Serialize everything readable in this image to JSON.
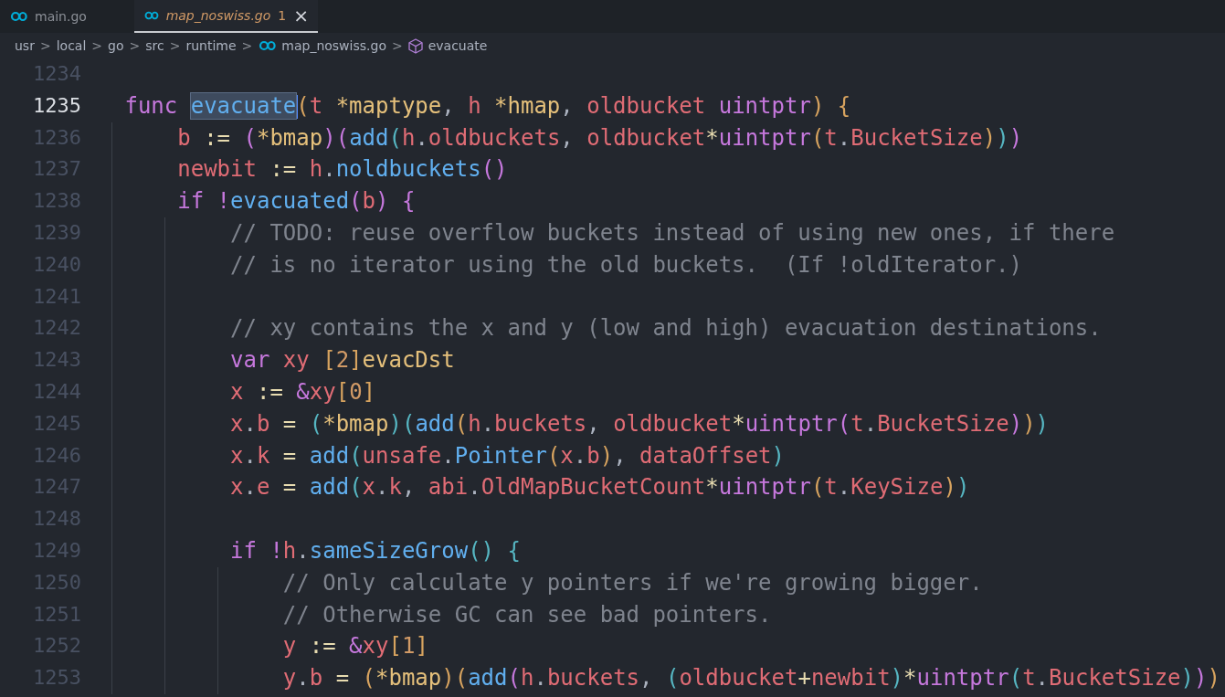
{
  "tabs": [
    {
      "label": "main.go",
      "selected": false,
      "italic": false
    },
    {
      "label": "map_noswiss.go",
      "selected": true,
      "italic": true,
      "problems": "1",
      "close": "×"
    }
  ],
  "breadcrumbs": [
    {
      "label": "usr",
      "kind": "folder"
    },
    {
      "label": "local",
      "kind": "folder"
    },
    {
      "label": "go",
      "kind": "folder"
    },
    {
      "label": "src",
      "kind": "folder"
    },
    {
      "label": "runtime",
      "kind": "folder"
    },
    {
      "label": "map_noswiss.go",
      "kind": "file"
    },
    {
      "label": "evacuate",
      "kind": "symbol"
    }
  ],
  "separator": ">",
  "lines": [
    {
      "number": "1234",
      "current": false
    },
    {
      "number": "1235",
      "current": true,
      "tokens": [
        {
          "text": "func ",
          "kind": "kw"
        },
        {
          "text": "evacuate",
          "kind": "fn",
          "selected": true
        },
        {
          "text": "(",
          "kind": "b1"
        },
        {
          "text": "t ",
          "kind": "var"
        },
        {
          "text": "*maptype",
          "kind": "type"
        },
        {
          "text": ", ",
          "kind": "p"
        },
        {
          "text": "h ",
          "kind": "var"
        },
        {
          "text": "*hmap",
          "kind": "type"
        },
        {
          "text": ", ",
          "kind": "p"
        },
        {
          "text": "oldbucket ",
          "kind": "var"
        },
        {
          "text": "uintptr",
          "kind": "kw"
        },
        {
          "text": ") {",
          "kind": "b1"
        }
      ],
      "children": [
        {
          "number": "1236",
          "current": false,
          "tokens": [
            {
              "text": "b ",
              "kind": "var"
            },
            {
              "text": ":= ",
              "kind": "op"
            },
            {
              "text": "(",
              "kind": "b2"
            },
            {
              "text": "*bmap",
              "kind": "type"
            },
            {
              "text": ")(",
              "kind": "b2"
            },
            {
              "text": "add",
              "kind": "fn"
            },
            {
              "text": "(",
              "kind": "b3"
            },
            {
              "text": "h",
              "kind": "var"
            },
            {
              "text": ".",
              "kind": "p"
            },
            {
              "text": "oldbuckets",
              "kind": "var"
            },
            {
              "text": ", ",
              "kind": "p"
            },
            {
              "text": "oldbucket",
              "kind": "var"
            },
            {
              "text": "*",
              "kind": "op"
            },
            {
              "text": "uintptr",
              "kind": "kw"
            },
            {
              "text": "(",
              "kind": "b1"
            },
            {
              "text": "t",
              "kind": "var"
            },
            {
              "text": ".",
              "kind": "p"
            },
            {
              "text": "BucketSize",
              "kind": "var"
            },
            {
              "text": ")",
              "kind": "b1"
            },
            {
              "text": ")",
              "kind": "b3"
            },
            {
              "text": ")",
              "kind": "b2"
            }
          ]
        },
        {
          "number": "1237",
          "current": false,
          "tokens": [
            {
              "text": "newbit ",
              "kind": "var"
            },
            {
              "text": ":= ",
              "kind": "op"
            },
            {
              "text": "h",
              "kind": "var"
            },
            {
              "text": ".",
              "kind": "p"
            },
            {
              "text": "noldbuckets",
              "kind": "fn"
            },
            {
              "text": "()",
              "kind": "b2"
            }
          ]
        },
        {
          "number": "1238",
          "current": false,
          "tokens": [
            {
              "text": "if ",
              "kind": "kw"
            },
            {
              "text": "!",
              "kind": "kw"
            },
            {
              "text": "evacuated",
              "kind": "fn"
            },
            {
              "text": "(",
              "kind": "b2"
            },
            {
              "text": "b",
              "kind": "var"
            },
            {
              "text": ") {",
              "kind": "b2"
            }
          ],
          "children": [
            {
              "number": "1239",
              "current": false,
              "tokens": [
                {
                  "text": "// TODO: reuse overflow buckets instead of using new ones, if there",
                  "kind": "cm"
                }
              ]
            },
            {
              "number": "1240",
              "current": false,
              "tokens": [
                {
                  "text": "// is no iterator using the old buckets.  (If !oldIterator.)",
                  "kind": "cm"
                }
              ]
            },
            {
              "number": "1241",
              "current": false
            },
            {
              "number": "1242",
              "current": false,
              "tokens": [
                {
                  "text": "// xy contains the x and y (low and high) evacuation destinations.",
                  "kind": "cm"
                }
              ]
            },
            {
              "number": "1243",
              "current": false,
              "tokens": [
                {
                  "text": "var ",
                  "kind": "kw"
                },
                {
                  "text": "xy ",
                  "kind": "var"
                },
                {
                  "text": "[",
                  "kind": "b1"
                },
                {
                  "text": "2",
                  "kind": "num"
                },
                {
                  "text": "]",
                  "kind": "b1"
                },
                {
                  "text": "evacDst",
                  "kind": "type"
                }
              ]
            },
            {
              "number": "1244",
              "current": false,
              "tokens": [
                {
                  "text": "x ",
                  "kind": "var"
                },
                {
                  "text": ":= ",
                  "kind": "op"
                },
                {
                  "text": "&",
                  "kind": "kw"
                },
                {
                  "text": "xy",
                  "kind": "var"
                },
                {
                  "text": "[",
                  "kind": "b1"
                },
                {
                  "text": "0",
                  "kind": "num"
                },
                {
                  "text": "]",
                  "kind": "b1"
                }
              ]
            },
            {
              "number": "1245",
              "current": false,
              "tokens": [
                {
                  "text": "x",
                  "kind": "var"
                },
                {
                  "text": ".",
                  "kind": "p"
                },
                {
                  "text": "b ",
                  "kind": "var"
                },
                {
                  "text": "= ",
                  "kind": "op"
                },
                {
                  "text": "(",
                  "kind": "b3"
                },
                {
                  "text": "*bmap",
                  "kind": "type"
                },
                {
                  "text": ")(",
                  "kind": "b3"
                },
                {
                  "text": "add",
                  "kind": "fn"
                },
                {
                  "text": "(",
                  "kind": "b1"
                },
                {
                  "text": "h",
                  "kind": "var"
                },
                {
                  "text": ".",
                  "kind": "p"
                },
                {
                  "text": "buckets",
                  "kind": "var"
                },
                {
                  "text": ", ",
                  "kind": "p"
                },
                {
                  "text": "oldbucket",
                  "kind": "var"
                },
                {
                  "text": "*",
                  "kind": "op"
                },
                {
                  "text": "uintptr",
                  "kind": "kw"
                },
                {
                  "text": "(",
                  "kind": "b2"
                },
                {
                  "text": "t",
                  "kind": "var"
                },
                {
                  "text": ".",
                  "kind": "p"
                },
                {
                  "text": "BucketSize",
                  "kind": "var"
                },
                {
                  "text": ")",
                  "kind": "b2"
                },
                {
                  "text": ")",
                  "kind": "b1"
                },
                {
                  "text": ")",
                  "kind": "b3"
                }
              ]
            },
            {
              "number": "1246",
              "current": false,
              "tokens": [
                {
                  "text": "x",
                  "kind": "var"
                },
                {
                  "text": ".",
                  "kind": "p"
                },
                {
                  "text": "k ",
                  "kind": "var"
                },
                {
                  "text": "= ",
                  "kind": "op"
                },
                {
                  "text": "add",
                  "kind": "fn"
                },
                {
                  "text": "(",
                  "kind": "b3"
                },
                {
                  "text": "unsafe",
                  "kind": "var"
                },
                {
                  "text": ".",
                  "kind": "p"
                },
                {
                  "text": "Pointer",
                  "kind": "fn"
                },
                {
                  "text": "(",
                  "kind": "b1"
                },
                {
                  "text": "x",
                  "kind": "var"
                },
                {
                  "text": ".",
                  "kind": "p"
                },
                {
                  "text": "b",
                  "kind": "var"
                },
                {
                  "text": ")",
                  "kind": "b1"
                },
                {
                  "text": ", ",
                  "kind": "p"
                },
                {
                  "text": "dataOffset",
                  "kind": "var"
                },
                {
                  "text": ")",
                  "kind": "b3"
                }
              ]
            },
            {
              "number": "1247",
              "current": false,
              "tokens": [
                {
                  "text": "x",
                  "kind": "var"
                },
                {
                  "text": ".",
                  "kind": "p"
                },
                {
                  "text": "e ",
                  "kind": "var"
                },
                {
                  "text": "= ",
                  "kind": "op"
                },
                {
                  "text": "add",
                  "kind": "fn"
                },
                {
                  "text": "(",
                  "kind": "b3"
                },
                {
                  "text": "x",
                  "kind": "var"
                },
                {
                  "text": ".",
                  "kind": "p"
                },
                {
                  "text": "k",
                  "kind": "var"
                },
                {
                  "text": ", ",
                  "kind": "p"
                },
                {
                  "text": "abi",
                  "kind": "var"
                },
                {
                  "text": ".",
                  "kind": "p"
                },
                {
                  "text": "OldMapBucketCount",
                  "kind": "var"
                },
                {
                  "text": "*",
                  "kind": "op"
                },
                {
                  "text": "uintptr",
                  "kind": "kw"
                },
                {
                  "text": "(",
                  "kind": "b1"
                },
                {
                  "text": "t",
                  "kind": "var"
                },
                {
                  "text": ".",
                  "kind": "p"
                },
                {
                  "text": "KeySize",
                  "kind": "var"
                },
                {
                  "text": ")",
                  "kind": "b1"
                },
                {
                  "text": ")",
                  "kind": "b3"
                }
              ]
            },
            {
              "number": "1248",
              "current": false
            },
            {
              "number": "1249",
              "current": false,
              "tokens": [
                {
                  "text": "if ",
                  "kind": "kw"
                },
                {
                  "text": "!",
                  "kind": "kw"
                },
                {
                  "text": "h",
                  "kind": "var"
                },
                {
                  "text": ".",
                  "kind": "p"
                },
                {
                  "text": "sameSizeGrow",
                  "kind": "fn"
                },
                {
                  "text": "() {",
                  "kind": "b3"
                }
              ],
              "children": [
                {
                  "number": "1250",
                  "current": false,
                  "tokens": [
                    {
                      "text": "// Only calculate y pointers if we're growing bigger.",
                      "kind": "cm"
                    }
                  ]
                },
                {
                  "number": "1251",
                  "current": false,
                  "tokens": [
                    {
                      "text": "// Otherwise GC can see bad pointers.",
                      "kind": "cm"
                    }
                  ]
                },
                {
                  "number": "1252",
                  "current": false,
                  "tokens": [
                    {
                      "text": "y ",
                      "kind": "var"
                    },
                    {
                      "text": ":= ",
                      "kind": "op"
                    },
                    {
                      "text": "&",
                      "kind": "kw"
                    },
                    {
                      "text": "xy",
                      "kind": "var"
                    },
                    {
                      "text": "[",
                      "kind": "b1"
                    },
                    {
                      "text": "1",
                      "kind": "num"
                    },
                    {
                      "text": "]",
                      "kind": "b1"
                    }
                  ]
                },
                {
                  "number": "1253",
                  "current": false,
                  "tokens": [
                    {
                      "text": "y",
                      "kind": "var"
                    },
                    {
                      "text": ".",
                      "kind": "p"
                    },
                    {
                      "text": "b ",
                      "kind": "var"
                    },
                    {
                      "text": "= ",
                      "kind": "op"
                    },
                    {
                      "text": "(",
                      "kind": "b1"
                    },
                    {
                      "text": "*bmap",
                      "kind": "type"
                    },
                    {
                      "text": ")(",
                      "kind": "b1"
                    },
                    {
                      "text": "add",
                      "kind": "fn"
                    },
                    {
                      "text": "(",
                      "kind": "b2"
                    },
                    {
                      "text": "h",
                      "kind": "var"
                    },
                    {
                      "text": ".",
                      "kind": "p"
                    },
                    {
                      "text": "buckets",
                      "kind": "var"
                    },
                    {
                      "text": ", ",
                      "kind": "p"
                    },
                    {
                      "text": "(",
                      "kind": "b3"
                    },
                    {
                      "text": "oldbucket",
                      "kind": "var"
                    },
                    {
                      "text": "+",
                      "kind": "op"
                    },
                    {
                      "text": "newbit",
                      "kind": "var"
                    },
                    {
                      "text": ")",
                      "kind": "b3"
                    },
                    {
                      "text": "*",
                      "kind": "op"
                    },
                    {
                      "text": "uintptr",
                      "kind": "kw"
                    },
                    {
                      "text": "(",
                      "kind": "b3"
                    },
                    {
                      "text": "t",
                      "kind": "var"
                    },
                    {
                      "text": ".",
                      "kind": "p"
                    },
                    {
                      "text": "BucketSize",
                      "kind": "var"
                    },
                    {
                      "text": ")",
                      "kind": "b3"
                    },
                    {
                      "text": ")",
                      "kind": "b2"
                    },
                    {
                      "text": ")",
                      "kind": "b1"
                    }
                  ]
                }
              ]
            }
          ]
        }
      ]
    }
  ]
}
